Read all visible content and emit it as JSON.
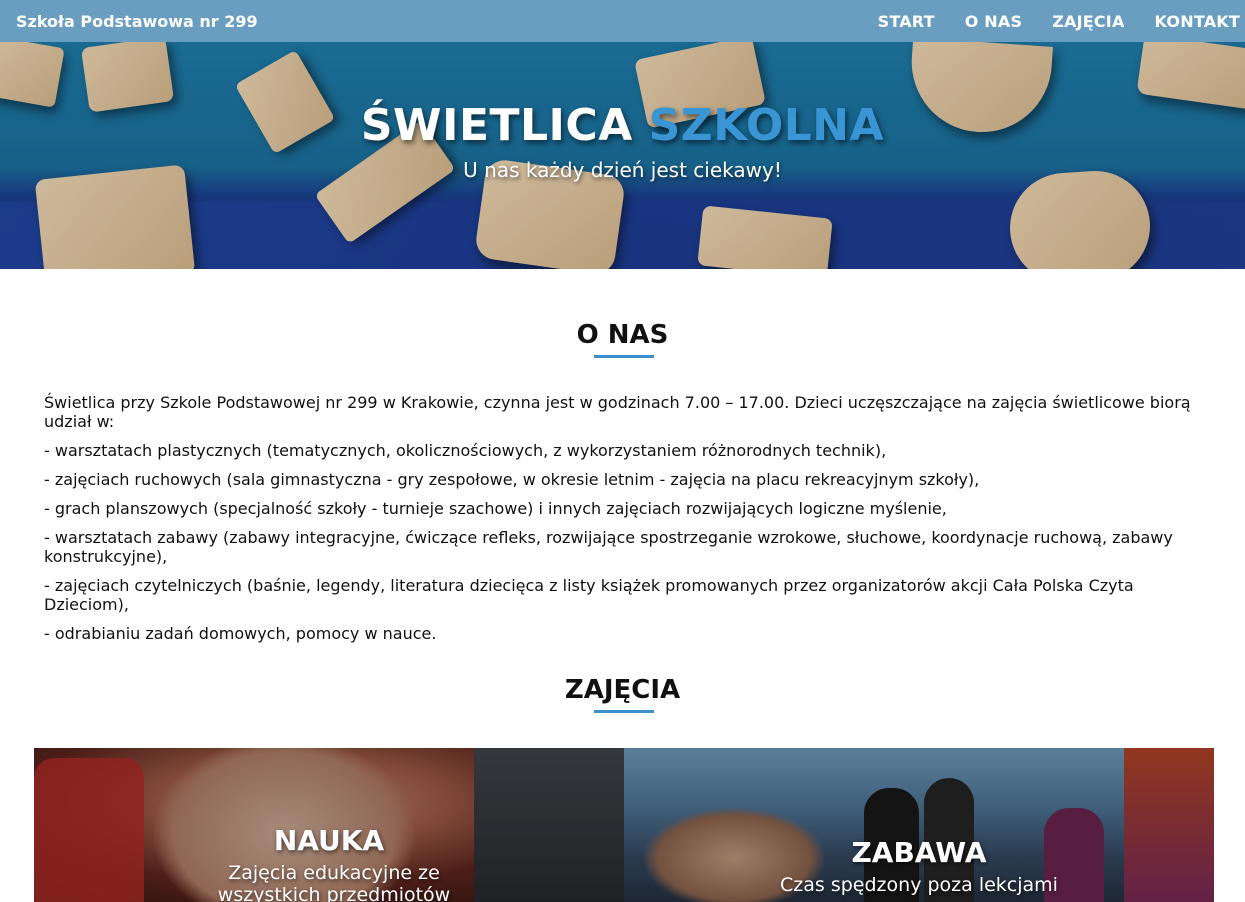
{
  "nav": {
    "brand": "Szkoła Podstawowa nr 299",
    "links": [
      "START",
      "O NAS",
      "ZAJĘCIA",
      "KONTAKT"
    ]
  },
  "hero": {
    "title_white": "ŚWIETLICA",
    "title_accent": "SZKOLNA",
    "subtitle": "U nas każdy dzień jest ciekawy!"
  },
  "about": {
    "heading": "O NAS",
    "paragraphs": [
      "Świetlica przy Szkole Podstawowej nr 299 w Krakowie, czynna jest w godzinach 7.00 – 17.00. Dzieci uczęszczające na zajęcia świetlicowe biorą udział w:",
      "- warsztatach plastycznych (tematycznych, okolicznościowych, z wykorzystaniem różnorodnych technik),",
      "- zajęciach ruchowych (sala gimnastyczna - gry zespołowe, w okresie letnim - zajęcia na placu rekreacyjnym szkoły),",
      "- grach planszowych (specjalność szkoły - turnieje szachowe) i innych zajęciach rozwijających logiczne myślenie,",
      "- warsztatach zabawy (zabawy integracyjne, ćwiczące refleks, rozwijające spostrzeganie wzrokowe, słuchowe, koordynacje ruchową, zabawy konstrukcyjne),",
      "- zajęciach czytelniczych (baśnie, legendy, literatura dziecięca z listy książek promowanych przez organizatorów akcji Cała Polska Czyta Dzieciom),",
      "- odrabianiu zadań domowych, pomocy w nauce."
    ]
  },
  "activities": {
    "heading": "ZAJĘCIA",
    "cards": [
      {
        "title": "NAUKA",
        "description": "Zajęcia edukacyjne ze wszystkich przedmiotów"
      },
      {
        "title": "ZABAWA",
        "description": "Czas spędzony poza lekcjami w"
      }
    ]
  },
  "colors": {
    "navbar": "#6a9ec0",
    "accent": "#3a95d4",
    "underline": "#3a8fcd"
  }
}
